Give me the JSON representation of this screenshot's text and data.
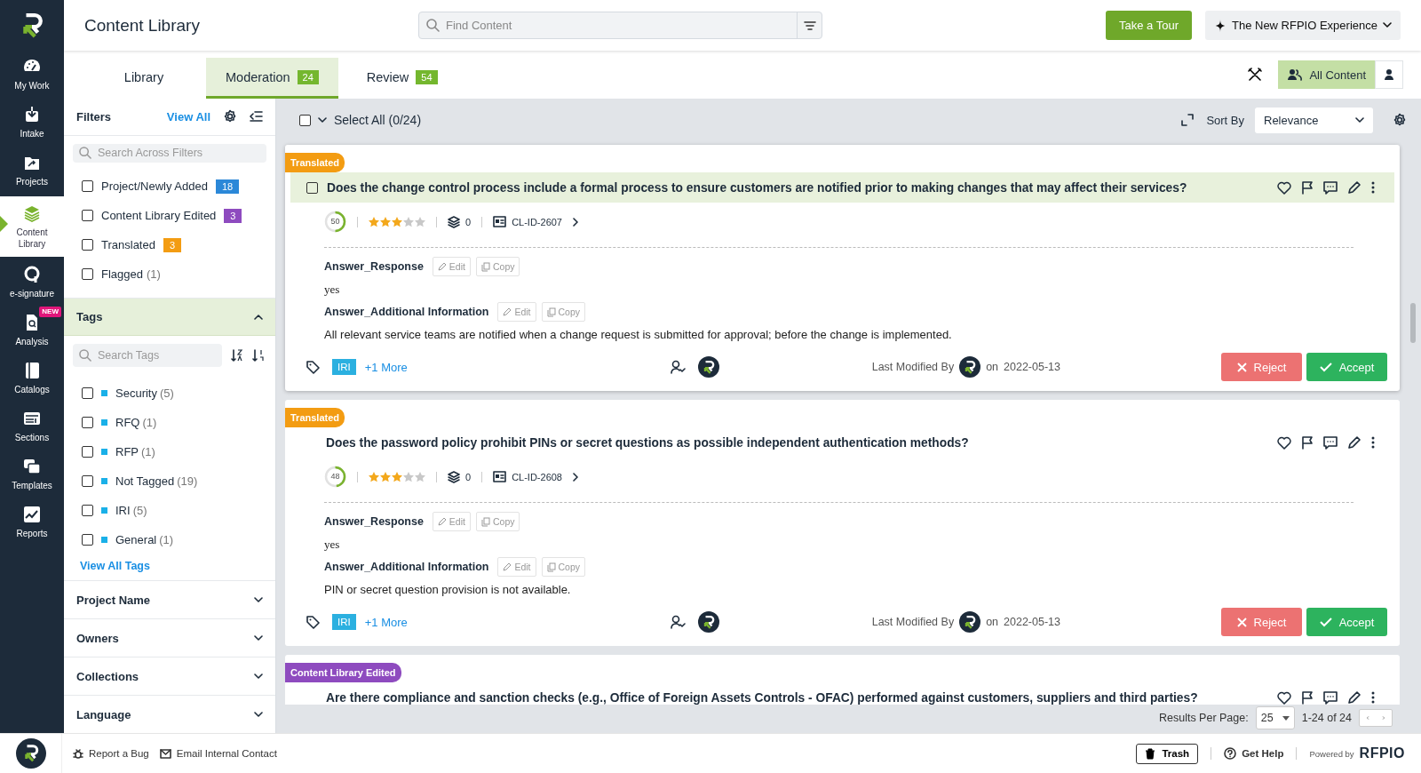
{
  "app": {
    "title": "Content Library"
  },
  "nav": [
    {
      "kind": "gauge",
      "label": "My Work",
      "selected": false
    },
    {
      "kind": "intake",
      "label": "Intake",
      "selected": false
    },
    {
      "kind": "folder",
      "label": "Projects",
      "selected": false
    },
    {
      "kind": "stack",
      "label": "Content Library",
      "selected": true
    },
    {
      "kind": "esign",
      "label": "e-signature",
      "selected": false
    },
    {
      "kind": "doc",
      "label": "Analysis",
      "badge": "NEW",
      "selected": false
    },
    {
      "kind": "book",
      "label": "Catalogs",
      "selected": false
    },
    {
      "kind": "sections",
      "label": "Sections",
      "selected": false
    },
    {
      "kind": "templates",
      "label": "Templates",
      "selected": false
    },
    {
      "kind": "chart",
      "label": "Reports",
      "selected": false
    }
  ],
  "header": {
    "search_placeholder": "Find Content",
    "tour_button": "Take a Tour",
    "experience_button": "The New RFPIO Experience"
  },
  "tabs": [
    {
      "label": "Library",
      "selected": false
    },
    {
      "label": "Moderation",
      "count": "24",
      "selected": true
    },
    {
      "label": "Review",
      "count": "54",
      "selected": false
    }
  ],
  "view_buttons": [
    {
      "kind": "all",
      "label": "All Content",
      "selected": true
    },
    {
      "kind": "mine",
      "selected": false
    }
  ],
  "filters": {
    "title": "Filters",
    "view_all": "View All",
    "search_placeholder": "Search Across Filters",
    "items": [
      {
        "label": "Project/Newly Added",
        "count": "18",
        "color": "#2b88d8",
        "checked": false
      },
      {
        "label": "Content Library Edited",
        "count": "3",
        "color": "#8e4bbf",
        "checked": false
      },
      {
        "label": "Translated",
        "count": "3",
        "color": "#f39c12",
        "checked": false
      },
      {
        "label": "Flagged",
        "count": "(1)",
        "checked": false
      }
    ]
  },
  "tags": {
    "title": "Tags",
    "expanded": true,
    "search_placeholder": "Search Tags",
    "view_all": "View All Tags",
    "items": [
      {
        "label": "Security",
        "count": "(5)",
        "checked": false
      },
      {
        "label": "RFQ",
        "count": "(1)",
        "checked": false
      },
      {
        "label": "RFP",
        "count": "(1)",
        "checked": false
      },
      {
        "label": "Not Tagged",
        "count": "(19)",
        "checked": false
      },
      {
        "label": "IRI",
        "count": "(5)",
        "checked": false
      },
      {
        "label": "General",
        "count": "(1)",
        "checked": false
      }
    ]
  },
  "sections": [
    {
      "title": "Project Name",
      "expanded": false
    },
    {
      "title": "Owners",
      "expanded": false
    },
    {
      "title": "Collections",
      "expanded": false
    },
    {
      "title": "Language",
      "expanded": false
    }
  ],
  "toolbar": {
    "select_all": "Select All (0/24)",
    "checked": false,
    "sort_label": "Sort By",
    "sort_value": "Relevance"
  },
  "cards": [
    {
      "badge": "Translated",
      "color": "#f39c12",
      "highlighted": true,
      "question": "Does the change control process include a formal process to ensure customers are notified prior to making changes that may affect their services?",
      "score": "50",
      "level": 0.5,
      "stars": 3,
      "versions": "0",
      "id": "CL-ID-2607",
      "answers": [
        {
          "label": "Answer_Response",
          "edit": "Edit",
          "copy": "Copy",
          "text": "yes"
        },
        {
          "label": "Answer_Additional Information",
          "edit": "Edit",
          "copy": "Copy",
          "text": "All relevant service teams are notified when a change request is submitted for approval; before the change is implemented."
        }
      ],
      "tag": "IRI",
      "more": "+1 More",
      "modified_label": "Last Modified By",
      "on": "on",
      "date": "2022-05-13",
      "reject": "Reject",
      "accept": "Accept"
    },
    {
      "badge": "Translated",
      "color": "#f39c12",
      "highlighted": false,
      "question": "Does the password policy prohibit PINs or secret questions as possible independent authentication methods?",
      "score": "48",
      "level": 0.48,
      "stars": 3,
      "versions": "0",
      "id": "CL-ID-2608",
      "answers": [
        {
          "label": "Answer_Response",
          "edit": "Edit",
          "copy": "Copy",
          "text": "yes"
        },
        {
          "label": "Answer_Additional Information",
          "edit": "Edit",
          "copy": "Copy",
          "text": "PIN or secret question provision is not available."
        }
      ],
      "tag": "IRI",
      "more": "+1 More",
      "modified_label": "Last Modified By",
      "on": "on",
      "date": "2022-05-13",
      "reject": "Reject",
      "accept": "Accept"
    },
    {
      "badge": "Content Library Edited",
      "color": "#8e4bbf",
      "highlighted": false,
      "question": "Are there compliance and sanction checks (e.g., Office of Foreign Assets Controls - OFAC) performed against customers, suppliers and third parties?"
    }
  ],
  "pagination": {
    "label": "Results Per Page:",
    "per_page": "25",
    "range": "1-24 of 24"
  },
  "footer": {
    "links": [
      {
        "kind": "bug",
        "label": "Report a Bug"
      },
      {
        "kind": "mail",
        "label": "Email Internal Contact"
      }
    ],
    "trash": "Trash",
    "help": "Get Help",
    "powered": "Powered by",
    "brand": "RFPIO"
  }
}
